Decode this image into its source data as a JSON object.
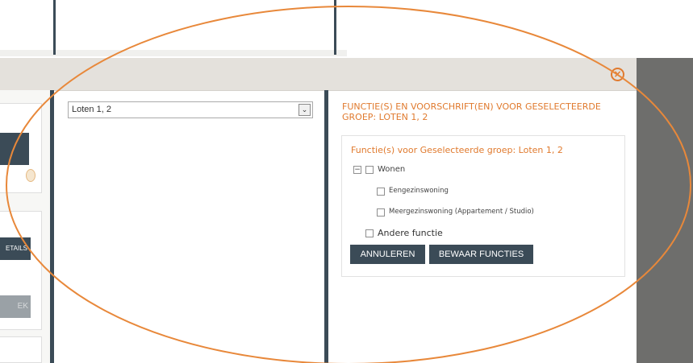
{
  "dialog": {
    "close_glyph": "×"
  },
  "left_panel": {
    "details_button_label": "ETAILS",
    "search_button_label": "EK"
  },
  "middle_panel": {
    "select": {
      "value": "Loten 1, 2",
      "arrow_glyph": "⌄"
    }
  },
  "right_panel": {
    "title": "FUNCTIE(S) EN VOORSCHRIFT(EN) VOOR GESELECTEERDE GROEP: LOTEN 1, 2",
    "subtitle": "Functie(s) voor Geselecteerde groep: Loten 1, 2",
    "tree": {
      "expander_glyph": "−",
      "wonen_label": "Wonen",
      "children": [
        "Eengezinswoning",
        "Meergezinswoning (Appartement / Studio)"
      ],
      "andere_label": "Andere functie"
    },
    "buttons": {
      "cancel_label": "ANNULEREN",
      "save_label": "BEWAAR FUNCTIES"
    }
  },
  "colors": {
    "accent_orange": "#e07a2e",
    "dark_slate": "#3b4b57",
    "annotation_oval": "#e8883a"
  },
  "icons": {
    "close": "close-circle-icon",
    "select_arrow": "chevron-down-icon",
    "tree_toggle": "collapse-minus-icon"
  }
}
